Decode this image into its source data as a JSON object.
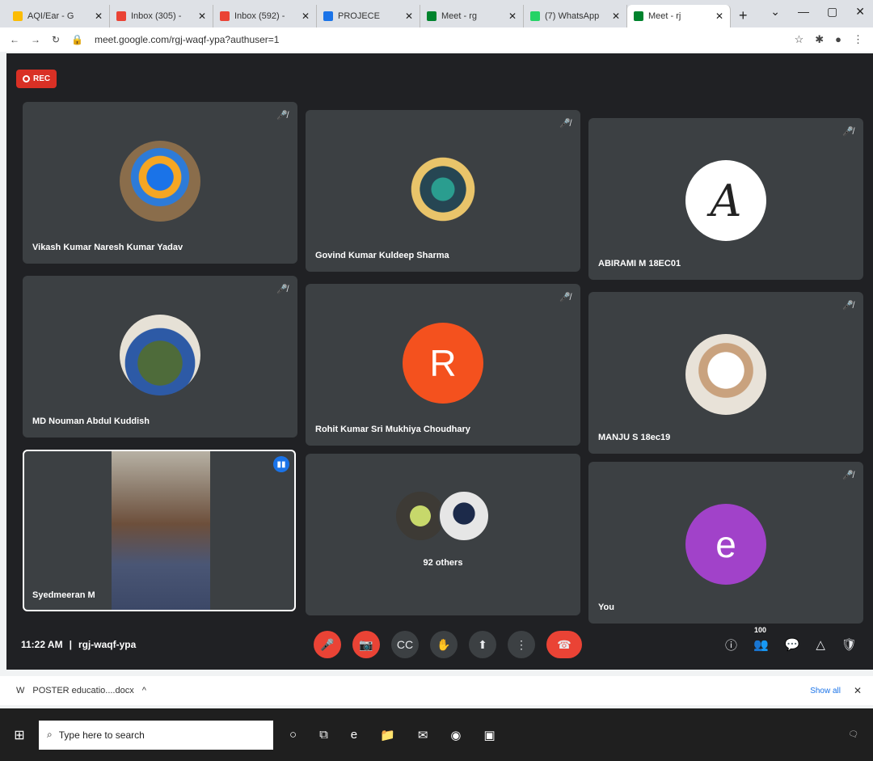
{
  "tabs": [
    {
      "title": "AQI/Ear - G",
      "color": "#fbbc04"
    },
    {
      "title": "Inbox (305) -",
      "color": "#ea4335"
    },
    {
      "title": "Inbox (592) -",
      "color": "#ea4335"
    },
    {
      "title": "PROJECE",
      "color": "#1a73e8"
    },
    {
      "title": "Meet - rg",
      "color": "#00832d"
    },
    {
      "title": "(7) WhatsApp",
      "color": "#25d366"
    },
    {
      "title": "Meet - rj",
      "color": "#00832d"
    }
  ],
  "browser": {
    "url": "meet.google.com/rgj-waqf-ypa?authuser=1"
  },
  "recording": {
    "label": "REC"
  },
  "participants": [
    {
      "name": "Vikash Kumar Naresh Kumar Yadav"
    },
    {
      "name": "Govind Kumar Kuldeep Sharma"
    },
    {
      "name": "ABIRAMI M 18EC01",
      "initial": "A"
    },
    {
      "name": "MD Nouman Abdul Kuddish"
    },
    {
      "name": "Rohit Kumar Sri Mukhiya Choudhary",
      "initial": "R",
      "color": "#f4511e"
    },
    {
      "name": "MANJU S 18ec19"
    },
    {
      "name": "Syedmeeran M"
    },
    {
      "name": "You",
      "initial": "e",
      "color": "#a142c9"
    }
  ],
  "others": {
    "label": "92 others"
  },
  "meeting": {
    "time": "11:22 AM",
    "code": "rgj-waqf-ypa"
  },
  "participant_count": "100",
  "downloads": {
    "file": "POSTER educatio....docx",
    "show_all": "Show all"
  },
  "taskbar": {
    "search_placeholder": "Type here to search"
  }
}
